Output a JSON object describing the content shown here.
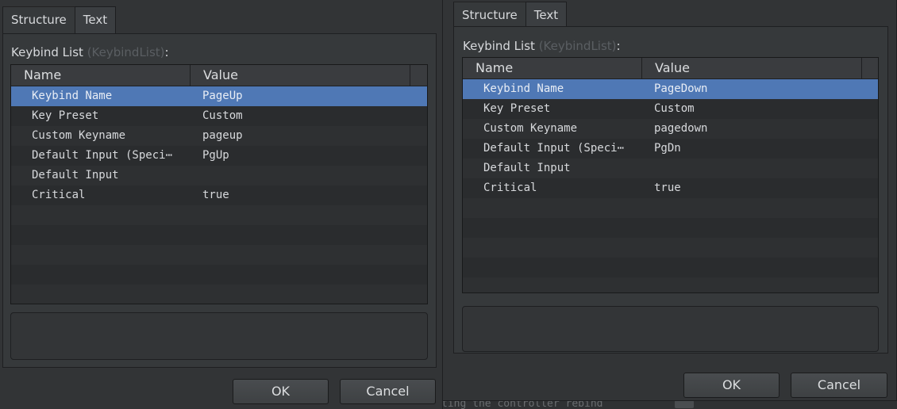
{
  "backdrop": {
    "text": "ting the controller rebind"
  },
  "dialogs": [
    {
      "tabs": [
        {
          "label": "Structure",
          "active": true
        },
        {
          "label": "Text",
          "active": false
        }
      ],
      "list_label": "Keybind List",
      "list_type": "(KeybindList)",
      "list_suffix": ":",
      "columns": {
        "name": "Name",
        "value": "Value"
      },
      "rows": [
        {
          "name": "Keybind Name",
          "value": "PageUp",
          "selected": true
        },
        {
          "name": "Key Preset",
          "value": "Custom"
        },
        {
          "name": "Custom Keyname",
          "value": "pageup"
        },
        {
          "name": "Default Input (Speci⋯",
          "value": "PgUp"
        },
        {
          "name": "Default Input",
          "value": ""
        },
        {
          "name": "Critical",
          "value": "true"
        }
      ],
      "buttons": {
        "ok": "OK",
        "cancel": "Cancel"
      }
    },
    {
      "tabs": [
        {
          "label": "Structure",
          "active": true
        },
        {
          "label": "Text",
          "active": false
        }
      ],
      "list_label": "Keybind List",
      "list_type": "(KeybindList)",
      "list_suffix": ":",
      "columns": {
        "name": "Name",
        "value": "Value"
      },
      "rows": [
        {
          "name": "Keybind Name",
          "value": "PageDown",
          "selected": true
        },
        {
          "name": "Key Preset",
          "value": "Custom"
        },
        {
          "name": "Custom Keyname",
          "value": "pagedown"
        },
        {
          "name": "Default Input (Speci⋯",
          "value": "PgDn"
        },
        {
          "name": "Default Input",
          "value": ""
        },
        {
          "name": "Critical",
          "value": "true"
        }
      ],
      "buttons": {
        "ok": "OK",
        "cancel": "Cancel"
      }
    }
  ],
  "colors": {
    "selection": "#4f78b5",
    "background": "#323436"
  }
}
